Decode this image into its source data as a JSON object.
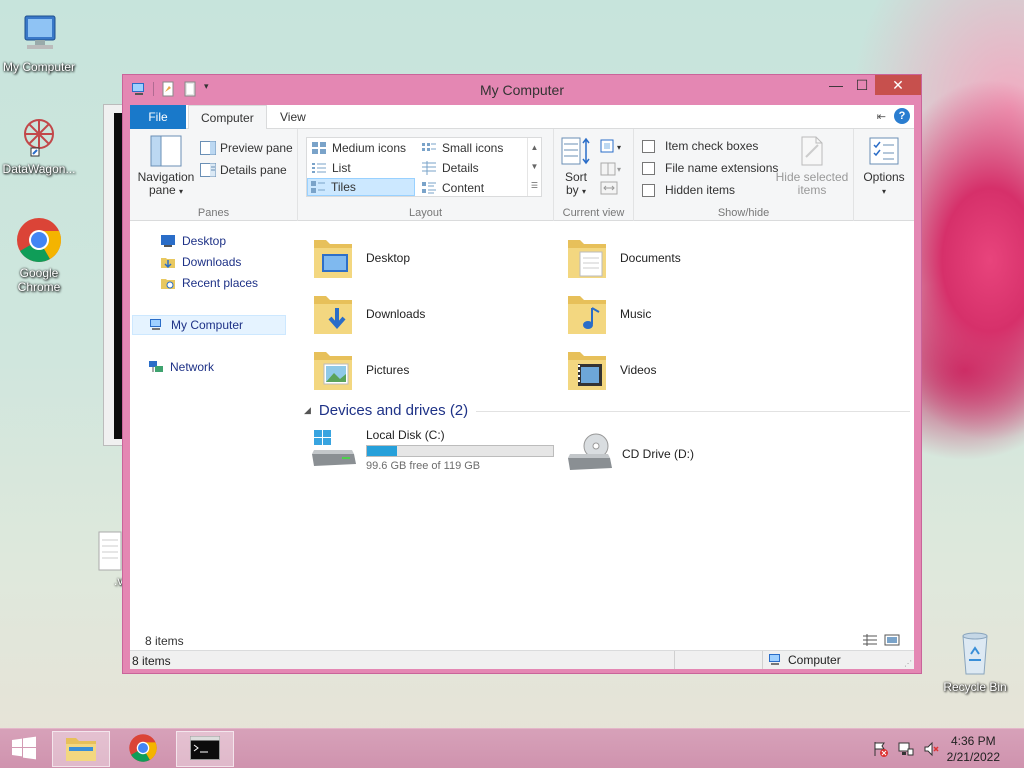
{
  "desktop": {
    "icons": [
      {
        "label": "My Computer"
      },
      {
        "label": "DataWagon..."
      },
      {
        "label": "Google Chrome"
      },
      {
        "label": ".vb"
      },
      {
        "label": "Recycle Bin"
      }
    ]
  },
  "window": {
    "title": "My Computer",
    "controls": {
      "minimize": "—",
      "maximize": "☐",
      "close": "✕"
    }
  },
  "ribbon": {
    "tabs": [
      "File",
      "Computer",
      "View"
    ],
    "panes": {
      "group_name": "Panes",
      "navigation_pane": "Navigation pane",
      "preview_pane": "Preview pane",
      "details_pane": "Details pane"
    },
    "layout": {
      "group_name": "Layout",
      "options": [
        "Medium icons",
        "Small icons",
        "List",
        "Details",
        "Tiles",
        "Content"
      ],
      "selected": "Tiles"
    },
    "current_view": {
      "group_name": "Current view",
      "sort_by": "Sort by"
    },
    "show_hide": {
      "group_name": "Show/hide",
      "item_check_boxes": "Item check boxes",
      "file_name_extensions": "File name extensions",
      "hidden_items": "Hidden items",
      "hide_selected_items": "Hide selected items"
    },
    "options": "Options"
  },
  "nav": {
    "items": [
      {
        "label": "Desktop"
      },
      {
        "label": "Downloads"
      },
      {
        "label": "Recent places"
      },
      {
        "label": "My Computer"
      },
      {
        "label": "Network"
      }
    ]
  },
  "content": {
    "folders": [
      {
        "label": "Desktop"
      },
      {
        "label": "Documents"
      },
      {
        "label": "Downloads"
      },
      {
        "label": "Music"
      },
      {
        "label": "Pictures"
      },
      {
        "label": "Videos"
      }
    ],
    "devices_header": "Devices and drives (2)",
    "drives": [
      {
        "label": "Local Disk (C:)",
        "free": "99.6 GB free of 119 GB",
        "used_fraction": 0.163
      },
      {
        "label": "CD Drive (D:)"
      }
    ]
  },
  "status": {
    "inner_count": "8 items",
    "count": "8 items",
    "location": "Computer"
  },
  "taskbar": {
    "time": "4:36 PM",
    "date": "2/21/2022"
  }
}
